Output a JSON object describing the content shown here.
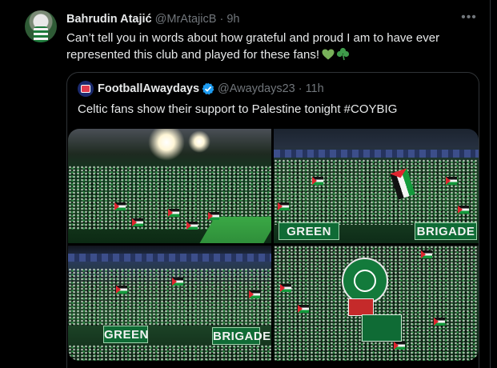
{
  "tweet": {
    "author_name": "Bahrudin Atajić",
    "author_handle": "@MrAtajicB",
    "separator": "·",
    "time": "9h",
    "text": "Can’t tell you in words about how grateful and proud I am to have ever represented this club and played for these fans!",
    "more_icon": "ellipsis-icon",
    "emojis": [
      "green-heart-icon",
      "shamrock-icon"
    ]
  },
  "quote": {
    "author_name": "FootballAwaydays",
    "verified": true,
    "author_handle": "@Awaydays23",
    "separator": "·",
    "time": "11h",
    "text": "Celtic fans show their support to Palestine tonight #COYBIG",
    "photos": [
      {
        "subject": "stadium-crowd-wide"
      },
      {
        "subject": "crowd-with-flags",
        "banners": [
          "GREEN",
          "BRIGADE"
        ]
      },
      {
        "subject": "lower-tier-crowd",
        "banners": [
          "GREEN",
          "BRIGADE"
        ]
      },
      {
        "subject": "fans-with-banners"
      }
    ]
  },
  "colors": {
    "background": "#000000",
    "text_primary": "#e7e9ea",
    "text_secondary": "#71767b",
    "border": "#2f3336",
    "verified_blue": "#1d9bf0",
    "celtic_green": "#0f6b35"
  }
}
